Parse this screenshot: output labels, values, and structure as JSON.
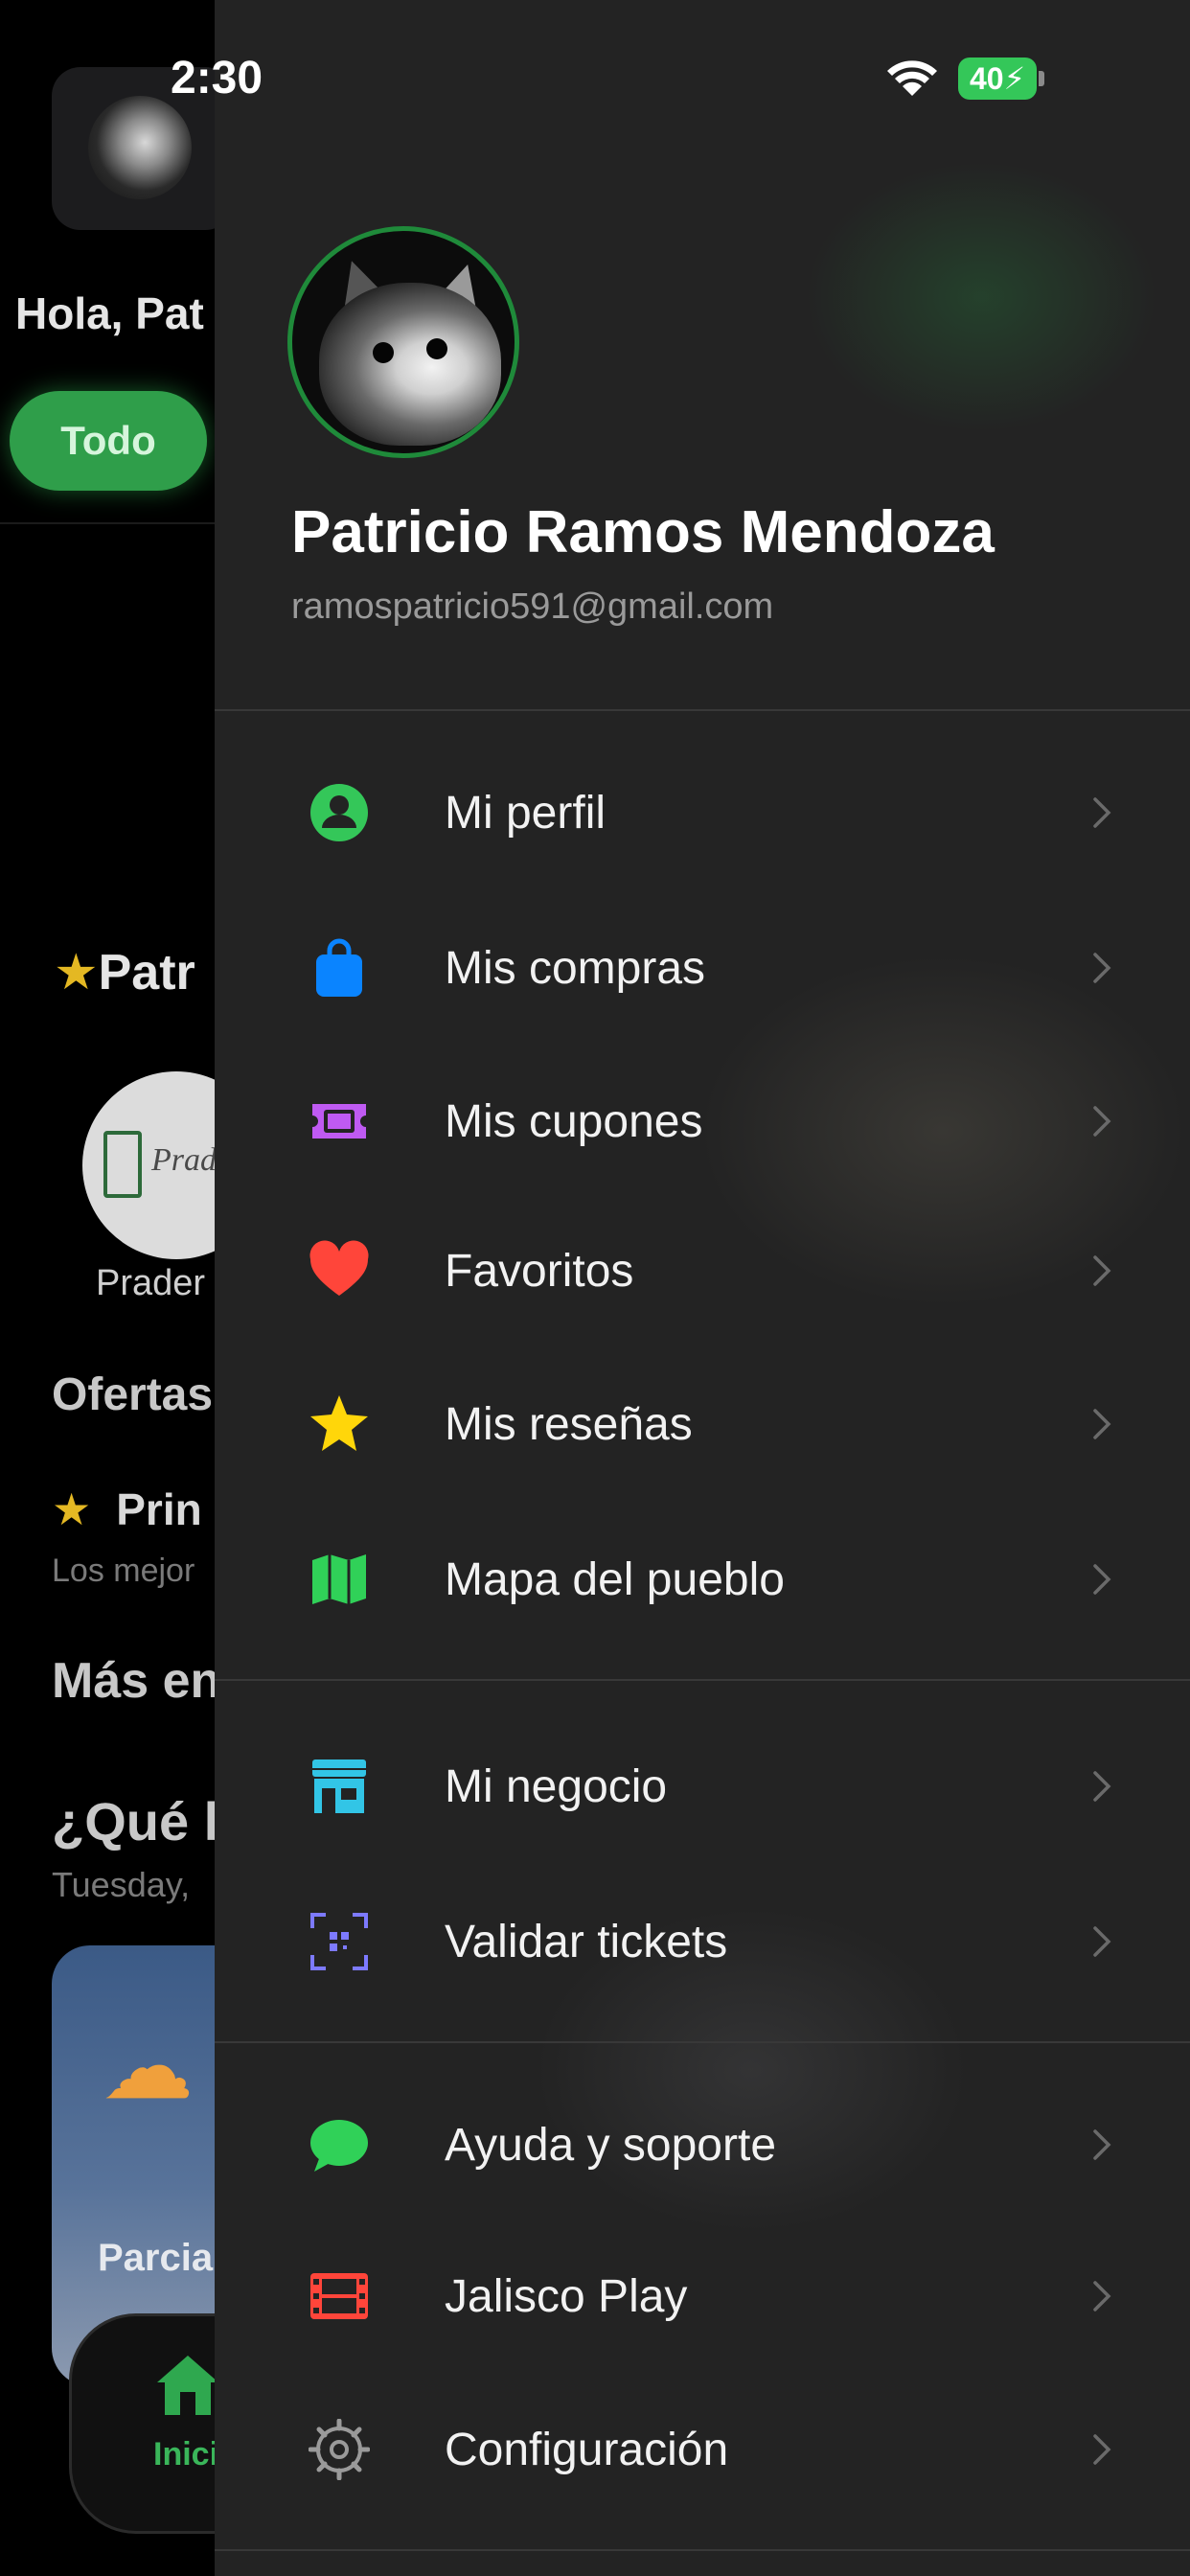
{
  "status_bar": {
    "time": "2:30",
    "battery": "40"
  },
  "background": {
    "greeting": "Hola, Pat",
    "filter_pill": "Todo",
    "section_title": "Patr",
    "logo_text": "Prad",
    "logo_label": "Prader",
    "ofertas": "Ofertas",
    "prin": "Prin",
    "mejores": "Los mejor",
    "mas": "Más en",
    "que": "¿Qué l",
    "date": "Tuesday,",
    "weather": "Parcia",
    "tab_home": "Inici"
  },
  "drawer": {
    "user": {
      "name": "Patricio Ramos Mendoza",
      "email": "ramospatricio591@gmail.com"
    },
    "menu": [
      {
        "label": "Mi perfil",
        "icon": "person-circle-icon",
        "color": "#34c759"
      },
      {
        "label": "Mis compras",
        "icon": "shopping-bag-icon",
        "color": "#0a84ff"
      },
      {
        "label": "Mis cupones",
        "icon": "coupon-ticket-icon",
        "color": "#bf5af2"
      },
      {
        "label": "Favoritos",
        "icon": "heart-icon",
        "color": "#ff453a"
      },
      {
        "label": "Mis reseñas",
        "icon": "star-icon",
        "color": "#ffd60a"
      },
      {
        "label": "Mapa del pueblo",
        "icon": "map-icon",
        "color": "#30d158"
      },
      {
        "label": "Mi negocio",
        "icon": "storefront-icon",
        "color": "#32c5e6"
      },
      {
        "label": "Validar tickets",
        "icon": "qr-scan-icon",
        "color": "#7d7aff"
      },
      {
        "label": "Ayuda y soporte",
        "icon": "chat-bubble-icon",
        "color": "#30d158"
      },
      {
        "label": "Jalisco Play",
        "icon": "film-icon",
        "color": "#ff453a"
      },
      {
        "label": "Configuración",
        "icon": "gear-icon",
        "color": "#9a9a9a"
      }
    ]
  }
}
